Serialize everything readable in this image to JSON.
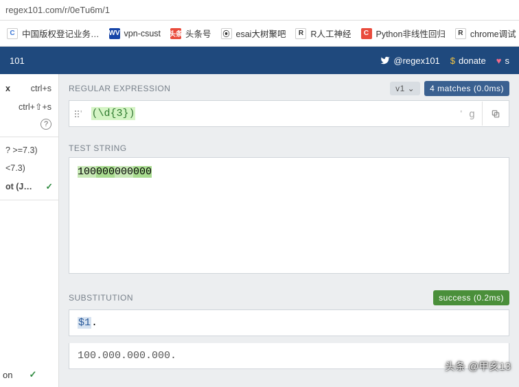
{
  "url": "regex101.com/r/0eTu6m/1",
  "bookmarks": [
    {
      "label": "中国版权登记业务…",
      "iconBg": "#fff",
      "iconFg": "#3a76d6",
      "iconTxt": "C"
    },
    {
      "label": "vpn-csust",
      "iconBg": "#1745a8",
      "iconFg": "#fff",
      "iconTxt": "WV"
    },
    {
      "label": "头条号",
      "iconBg": "#e94b3c",
      "iconFg": "#fff",
      "iconTxt": "头条"
    },
    {
      "label": "esai大树聚吧",
      "iconBg": "#fff",
      "iconFg": "#333",
      "iconTxt": "⦿"
    },
    {
      "label": "R人工神经",
      "iconBg": "#fff",
      "iconFg": "#333",
      "iconTxt": "R"
    },
    {
      "label": "Python非线性回归",
      "iconBg": "#e94b3c",
      "iconFg": "#fff",
      "iconTxt": "C"
    },
    {
      "label": "chrome调试",
      "iconBg": "#fff",
      "iconFg": "#333",
      "iconTxt": "R"
    }
  ],
  "header": {
    "left": "101",
    "twitter": "@regex101",
    "donate": "donate",
    "sponsor": "s"
  },
  "sidebar": {
    "ctrls_x": "x",
    "ctrls": "ctrl+s",
    "ctrlshifts": "ctrl+⇧+s",
    "items": [
      {
        "label": "? >=7.3)",
        "checked": false
      },
      {
        "label": "<7.3)",
        "checked": false
      },
      {
        "label": "ot (J…",
        "checked": true
      }
    ],
    "bottom": "on"
  },
  "regex": {
    "hdr": "REGULAR EXPRESSION",
    "version": "v1 ⌄",
    "matches": "4 matches (0.0ms)",
    "delimL": "'",
    "pattern_open": "(",
    "pattern_body": "\\d{3}",
    "pattern_close": ")",
    "delimR": "'",
    "flags": "g"
  },
  "test": {
    "hdr": "TEST STRING",
    "seg1": "100",
    "seg2": "000",
    "seg3": "000",
    "seg4": "000"
  },
  "sub": {
    "hdr": "SUBSTITUTION",
    "status": "success (0.2ms)",
    "var": "$1",
    "rest": ".",
    "result": "100.000.000.000."
  },
  "watermark": "头条 @甲亥13"
}
